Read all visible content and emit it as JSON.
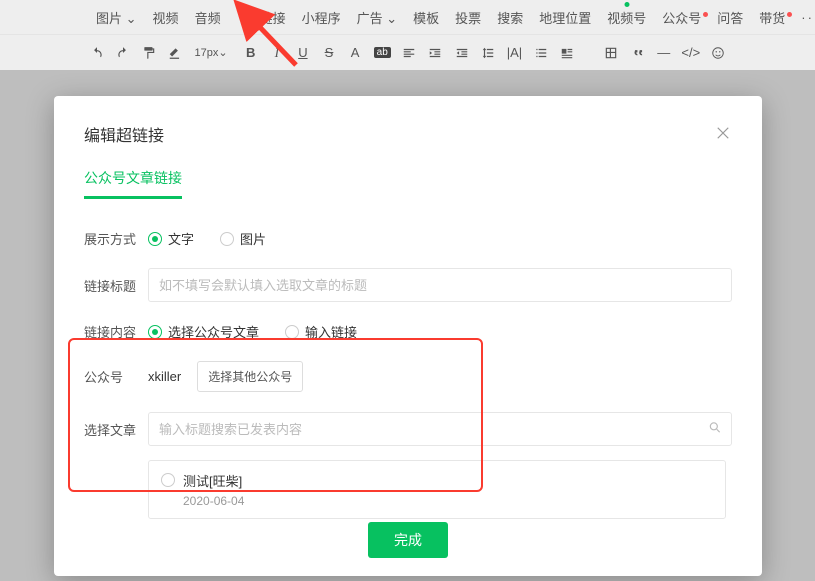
{
  "menubar": {
    "items": [
      {
        "label": "图片",
        "caret": true
      },
      {
        "label": "视频"
      },
      {
        "label": "音频"
      },
      {
        "label": "超链接"
      },
      {
        "label": "小程序"
      },
      {
        "label": "广告",
        "caret": true
      },
      {
        "label": "模板"
      },
      {
        "label": "投票"
      },
      {
        "label": "搜索"
      },
      {
        "label": "地理位置"
      },
      {
        "label": "视频号"
      },
      {
        "label": "公众号",
        "dot": true
      },
      {
        "label": "问答"
      },
      {
        "label": "带货",
        "dot": true
      }
    ],
    "more": "···"
  },
  "toolbar": {
    "font_size": "17px",
    "font_size_caret": "⌄"
  },
  "modal": {
    "title": "编辑超链接",
    "tab_active": "公众号文章链接",
    "display_mode_label": "展示方式",
    "display_mode_text": "文字",
    "display_mode_image": "图片",
    "link_title_label": "链接标题",
    "link_title_placeholder": "如不填写会默认填入选取文章的标题",
    "link_content_label": "链接内容",
    "link_content_article": "选择公众号文章",
    "link_content_url": "输入链接",
    "account_label": "公众号",
    "account_name": "xkiller",
    "select_other_account": "选择其他公众号",
    "select_article_label": "选择文章",
    "search_placeholder": "输入标题搜索已发表内容",
    "article": {
      "title": "测试[旺柴]",
      "date": "2020-06-04"
    },
    "submit": "完成"
  },
  "colors": {
    "accent": "#07c160",
    "red": "#fa3b2f"
  }
}
